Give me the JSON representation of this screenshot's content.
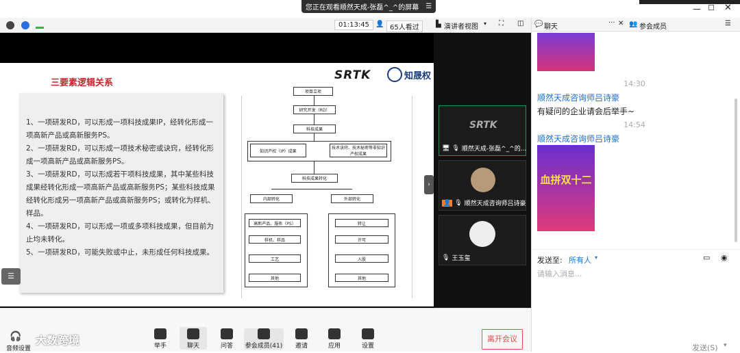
{
  "share_banner": {
    "text": "您正在观看顺然天成-张磊^_^的屏幕",
    "menu_icon": "menu-icon"
  },
  "topbar": {
    "timer": "01:13:45",
    "viewers": "65人看过",
    "view_mode": "演讲者视图"
  },
  "slide": {
    "title": "三要素逻辑关系",
    "brand": "SRTK",
    "brand2": "知晟权",
    "bullets": [
      "1、一项研发RD，可以形成一项科技成果IP，经转化形成一项高新产品或高新服务PS。",
      "2、一项研发RD，可以形成一项技术秘密或诀窍，经转化形成一项高新产品或高新服务PS。",
      "3、一项研发RD，可以形成若干项科技成果，其中某些科技成果经转化形成一项高新产品或高新服务PS；某些科技成果经转化形成另一项高新产品或高新服务PS；或转化为样机、样品。",
      "4、一项研发RD，可以形成一项或多项科技成果，但目前为止均未转化。",
      "5、一项研发RD，可能失败或中止，未形成任何科技成果。"
    ],
    "flow": {
      "n1": "项目立项",
      "n2": "研究开发（RD）",
      "n3": "科技成果",
      "n4": "知识产权（IP）成果",
      "n5": "技术诀窍、技术秘密等非知识产权成果",
      "n6": "科技成果转化",
      "n7": "内部转化",
      "n8": "外部转化",
      "l1": "高新产品、服务（PS）",
      "l2": "样机、样品",
      "l3": "工艺",
      "l4": "其他",
      "r1": "转让",
      "r2": "许可",
      "r3": "入股",
      "r4": "其他"
    }
  },
  "videos": [
    {
      "name": "顺然天成-张磊^_^的..."
    },
    {
      "name": "顺然天成咨询师吕诗豪"
    },
    {
      "name": "王玉玺"
    }
  ],
  "bottombar": {
    "audio": "音频设置",
    "watermark": "大数跨境",
    "buttons": [
      "举手",
      "聊天",
      "问答",
      "参会成员(41)",
      "邀请",
      "应用",
      "设置"
    ],
    "leave": "离开会议"
  },
  "panel": {
    "tab_chat": "聊天",
    "tab_members": "参会成员",
    "messages": [
      {
        "time": "14:30",
        "sender": "顺然天成咨询师吕诗豪",
        "text": "有疑问的企业请会后举手~"
      },
      {
        "time": "14:54",
        "sender": "顺然天成咨询师吕诗豪",
        "poster_text": "血拼双十二"
      }
    ],
    "send_to_label": "发送至:",
    "send_to_value": "所有人",
    "input_placeholder": "请输入消息...",
    "send_button": "发送(S)"
  },
  "colors": {
    "accent": "#1e6fd9",
    "leave": "#e14d4d",
    "title_red": "#c0282d"
  }
}
